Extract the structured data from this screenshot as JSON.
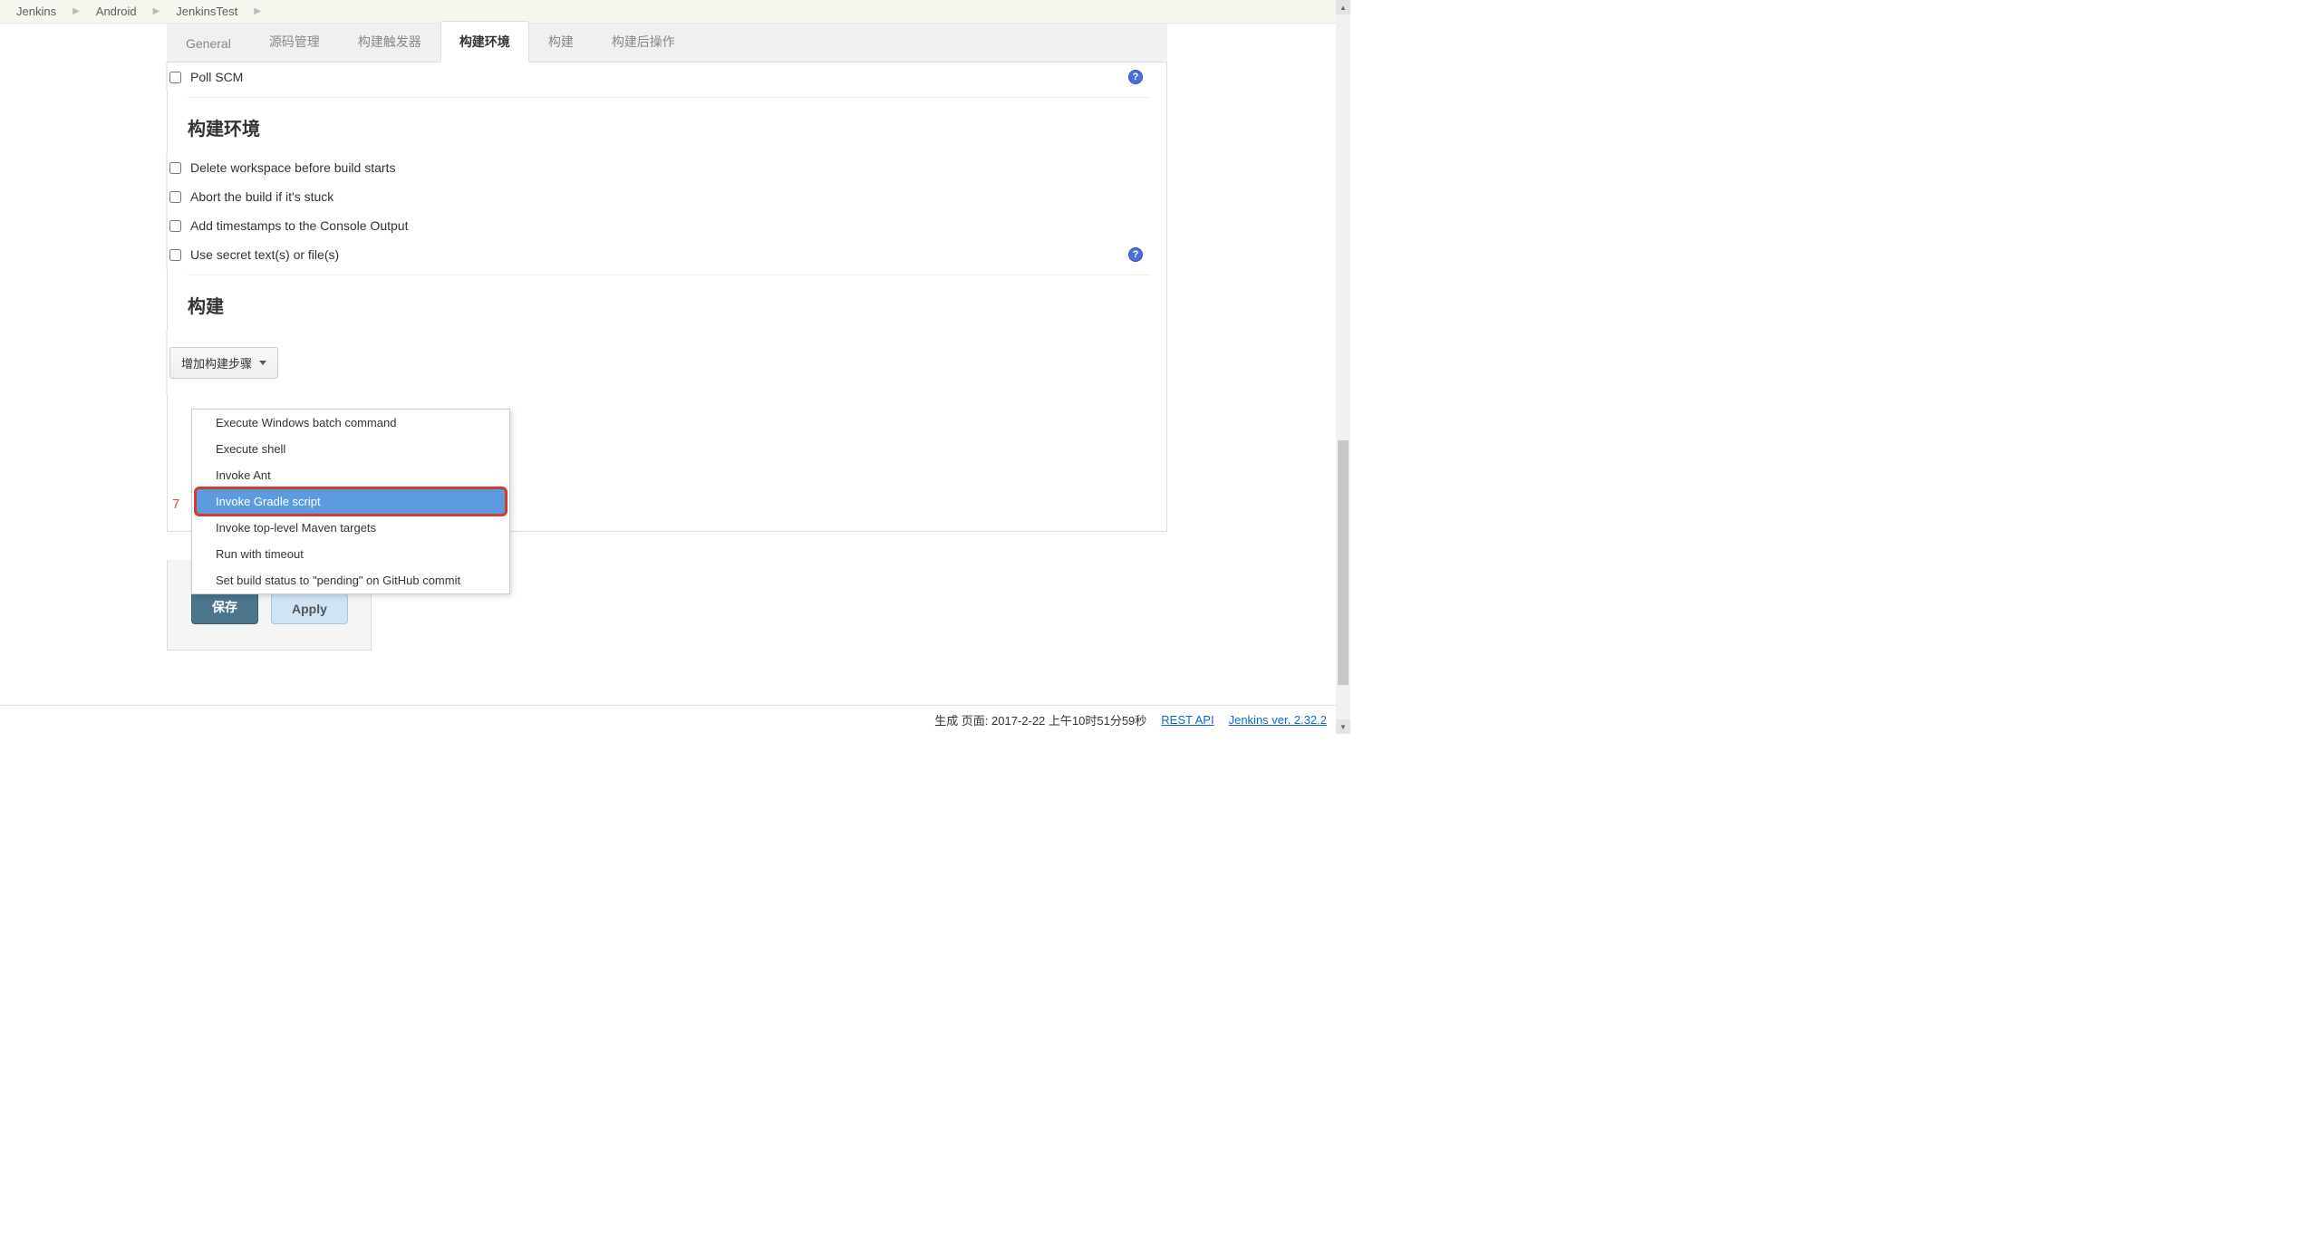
{
  "breadcrumb": {
    "items": [
      "Jenkins",
      "Android",
      "JenkinsTest"
    ]
  },
  "tabs": {
    "items": [
      {
        "label": "General"
      },
      {
        "label": "源码管理"
      },
      {
        "label": "构建触发器"
      },
      {
        "label": "构建环境",
        "active": true
      },
      {
        "label": "构建"
      },
      {
        "label": "构建后操作"
      }
    ]
  },
  "triggers": {
    "poll_scm": "Poll SCM"
  },
  "env": {
    "heading": "构建环境",
    "opts": [
      "Delete workspace before build starts",
      "Abort the build if it's stuck",
      "Add timestamps to the Console Output",
      "Use secret text(s) or file(s)"
    ]
  },
  "build": {
    "heading": "构建",
    "add_btn": "增加构建步骤",
    "menu": [
      "Execute Windows batch command",
      "Execute shell",
      "Invoke Ant",
      "Invoke Gradle script",
      "Invoke top-level Maven targets",
      "Run with timeout",
      "Set build status to \"pending\" on GitHub commit"
    ],
    "highlight_index": 3
  },
  "marker": "7",
  "buttons": {
    "save": "保存",
    "apply": "Apply"
  },
  "footer": {
    "gen": "生成 页面: 2017-2-22 上午10时51分59秒",
    "rest": "REST API",
    "ver": "Jenkins ver. 2.32.2"
  }
}
